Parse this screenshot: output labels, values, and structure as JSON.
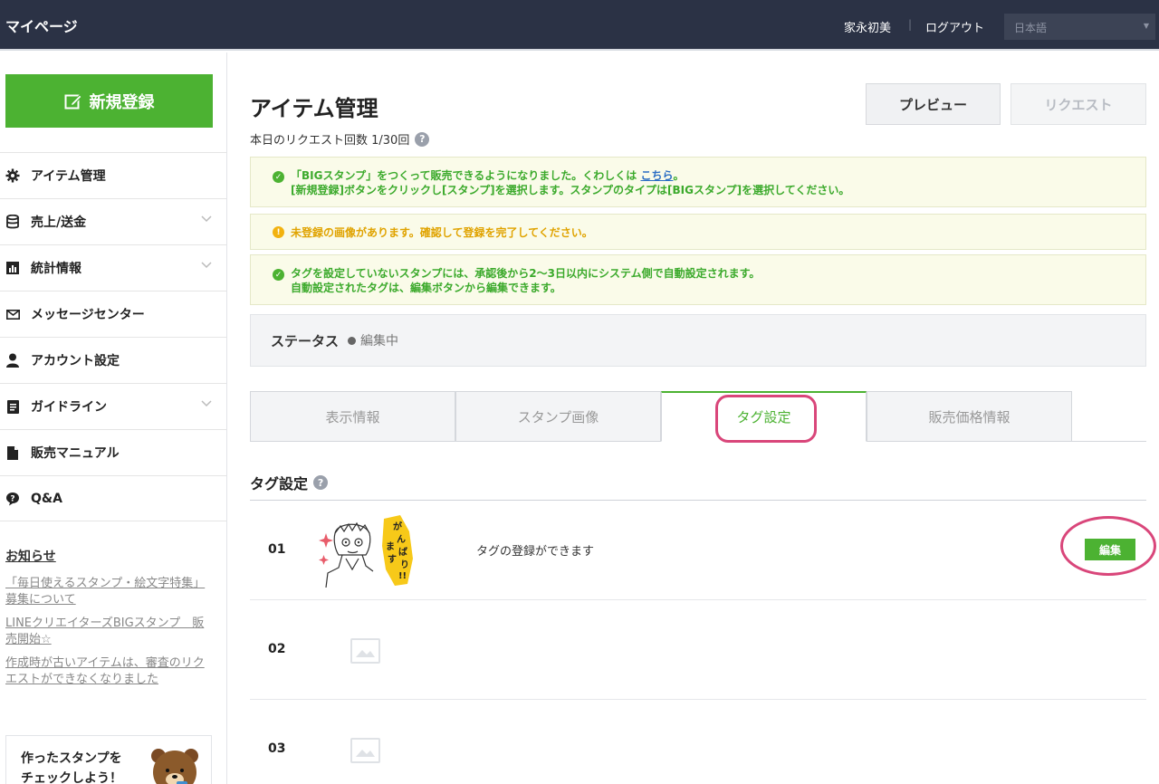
{
  "topbar": {
    "brand": "マイページ",
    "user_name": "家永初美",
    "separator": "|",
    "logout": "ログアウト",
    "language": "日本語"
  },
  "sidebar": {
    "new_button": "新規登録",
    "menu": [
      {
        "label": "アイテム管理",
        "icon": "gear-icon",
        "has_chevron": false
      },
      {
        "label": "売上/送金",
        "icon": "database-icon",
        "has_chevron": true
      },
      {
        "label": "統計情報",
        "icon": "chart-icon",
        "has_chevron": true
      },
      {
        "label": "メッセージセンター",
        "icon": "mail-icon",
        "has_chevron": false
      },
      {
        "label": "アカウント設定",
        "icon": "person-icon",
        "has_chevron": false
      },
      {
        "label": "ガイドライン",
        "icon": "document-icon",
        "has_chevron": true
      },
      {
        "label": "販売マニュアル",
        "icon": "file-icon",
        "has_chevron": false
      },
      {
        "label": "Q&A",
        "icon": "question-bubble-icon",
        "has_chevron": false
      }
    ],
    "news_title": "お知らせ",
    "news": [
      "「毎日使えるスタンプ・絵文字特集」募集について",
      "LINEクリエイターズBIGスタンプ　販売開始☆",
      "作成時が古いアイテムは、審査のリクエストができなくなりました"
    ],
    "promo_line1": "作ったスタンプを",
    "promo_line2": "チェックしよう！"
  },
  "main": {
    "title": "アイテム管理",
    "request_count": "本日のリクエスト回数 1/30回",
    "preview_button": "プレビュー",
    "request_button": "リクエスト",
    "notices": [
      {
        "type": "success",
        "line1_before": "「BIGスタンプ」をつくって販売できるようになりました。くわしくは ",
        "line1_link": "こちら",
        "line1_after": "。",
        "line2": "[新規登録]ボタンをクリックし[スタンプ]を選択します。スタンプのタイプは[BIGスタンプ]を選択してください。"
      },
      {
        "type": "warning",
        "line1": "未登録の画像があります。確認して登録を完了してください。"
      },
      {
        "type": "success",
        "line1": "タグを設定していないスタンプには、承認後から2〜3日以内にシステム側で自動設定されます。",
        "line2": "自動設定されたタグは、編集ボタンから編集できます。"
      }
    ],
    "status_label": "ステータス",
    "status_value": "編集中",
    "tabs": [
      "表示情報",
      "スタンプ画像",
      "タグ設定",
      "販売価格情報"
    ],
    "active_tab": 2,
    "section_title": "タグ設定",
    "rows": [
      {
        "num": "01",
        "desc": "タグの登録ができます",
        "edit": "編集",
        "has_image": true
      },
      {
        "num": "02",
        "desc": "",
        "edit": "",
        "has_image": false
      },
      {
        "num": "03",
        "desc": "",
        "edit": "",
        "has_image": false
      }
    ]
  },
  "colors": {
    "accent_green": "#4cb232",
    "topbar_bg": "#2b3245",
    "highlight_pink": "#d9467a",
    "warning_yellow": "#f2b20f",
    "link_blue": "#2c6ec4"
  }
}
